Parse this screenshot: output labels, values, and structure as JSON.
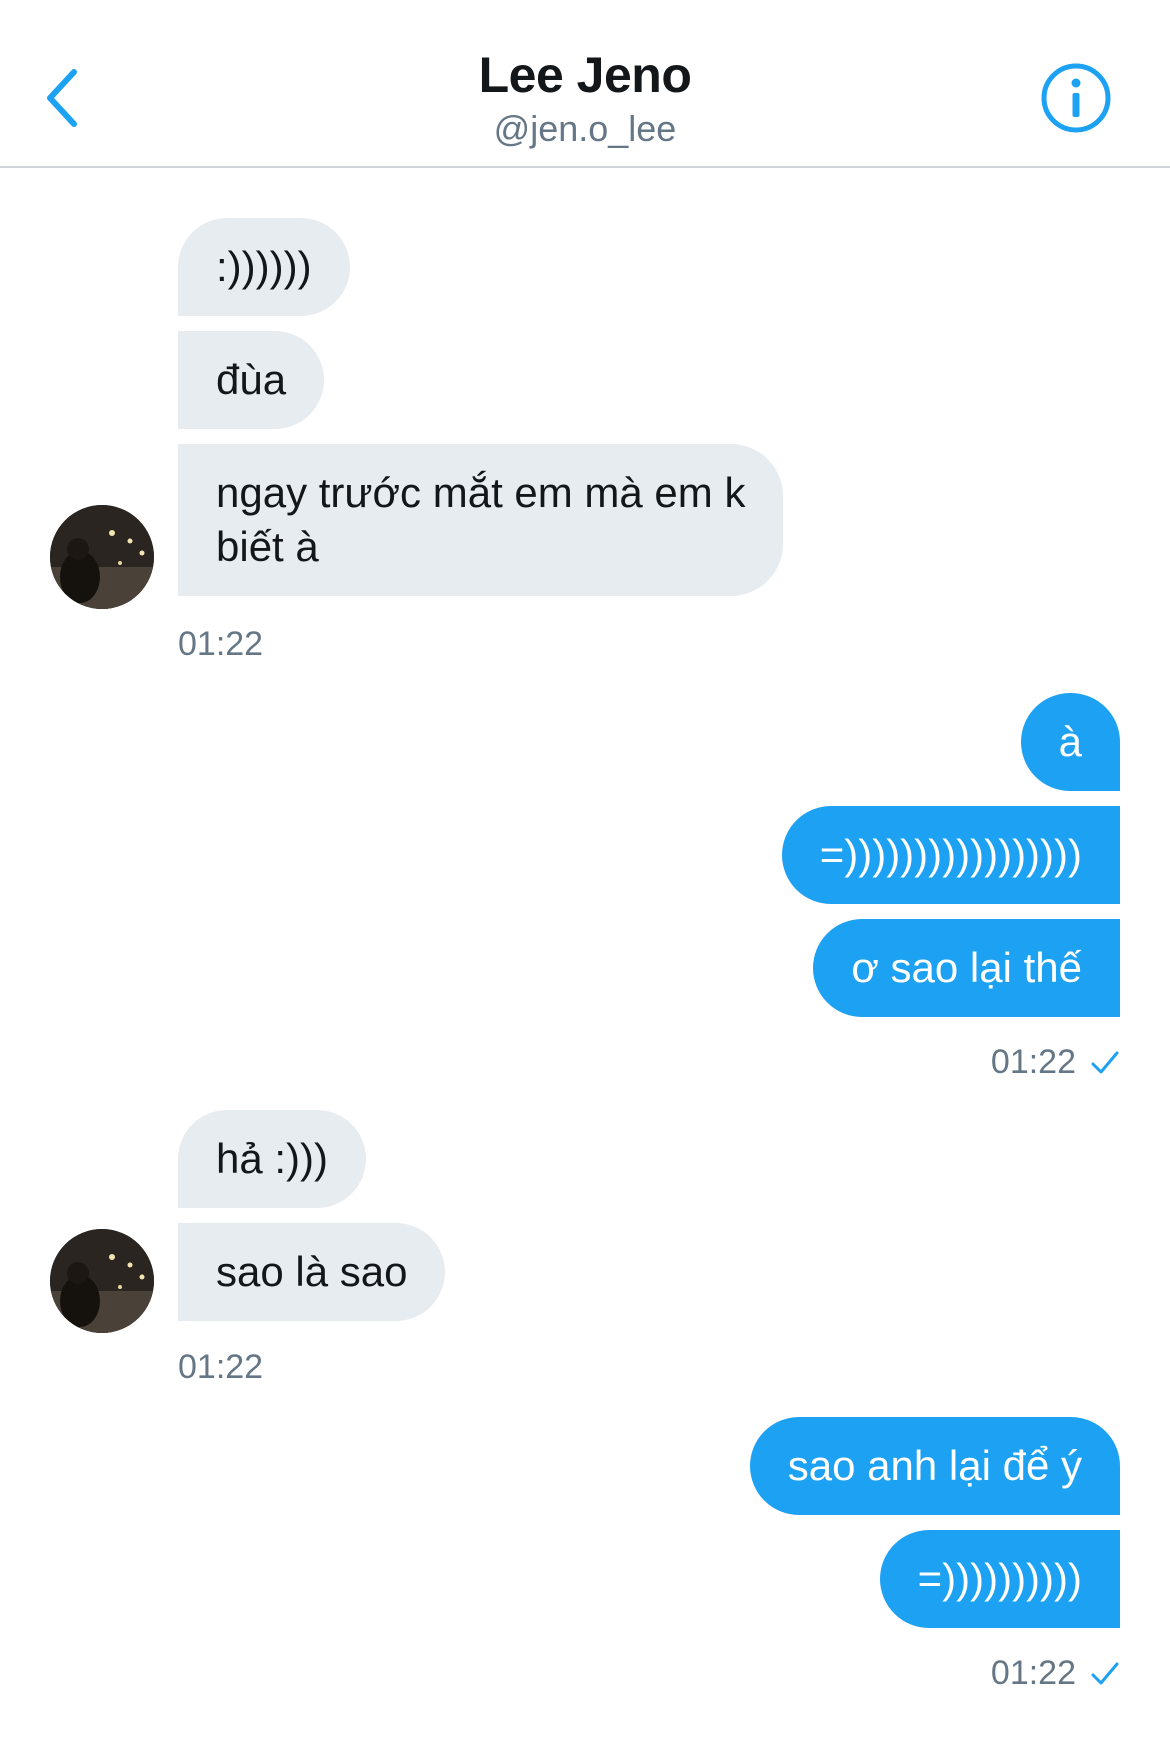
{
  "header": {
    "title": "Lee Jeno",
    "handle": "@jen.o_lee",
    "back_icon": "chevron-left-icon",
    "info_icon": "info-circle-icon",
    "accent_color": "#1da1f2"
  },
  "messages": [
    {
      "sender": "other",
      "text": ":))))))"
    },
    {
      "sender": "other",
      "text": "đùa"
    },
    {
      "sender": "other",
      "text": "ngay trước mắt em mà em k",
      "text2": "biết à"
    },
    {
      "sender": "me",
      "text": "à"
    },
    {
      "sender": "me",
      "text": "=)))))))))))))))))"
    },
    {
      "sender": "me",
      "text": "ơ sao lại thế"
    },
    {
      "sender": "other",
      "text": "hả :)))"
    },
    {
      "sender": "other",
      "text": "sao là sao"
    },
    {
      "sender": "me",
      "text": "sao anh lại để ý"
    },
    {
      "sender": "me",
      "text": "=))))))))))"
    }
  ],
  "timestamps": [
    "01:22",
    "01:22",
    "01:22",
    "01:22"
  ],
  "read_icon": "checkmark-icon",
  "colors": {
    "received_bubble": "#e6ecf0",
    "sent_bubble": "#1da1f2",
    "meta_text": "#657786"
  }
}
